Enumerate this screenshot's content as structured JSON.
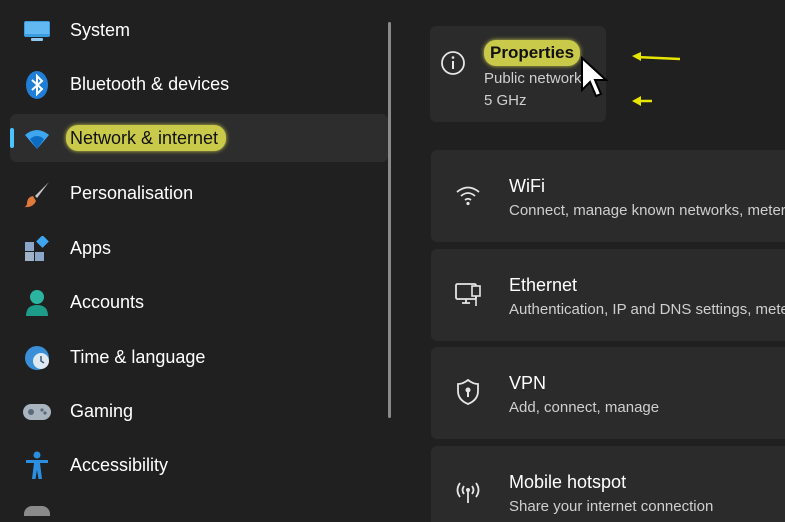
{
  "sidebar": {
    "items": [
      {
        "label": "System",
        "icon": "monitor-icon"
      },
      {
        "label": "Bluetooth & devices",
        "icon": "bluetooth-icon"
      },
      {
        "label": "Network & internet",
        "icon": "wifi-icon",
        "selected": true
      },
      {
        "label": "Personalisation",
        "icon": "brush-icon"
      },
      {
        "label": "Apps",
        "icon": "apps-icon"
      },
      {
        "label": "Accounts",
        "icon": "person-icon"
      },
      {
        "label": "Time & language",
        "icon": "globe-clock-icon"
      },
      {
        "label": "Gaming",
        "icon": "gamepad-icon"
      },
      {
        "label": "Accessibility",
        "icon": "accessibility-icon"
      }
    ]
  },
  "properties": {
    "title": "Properties",
    "network_type": "Public network",
    "band": "5 GHz",
    "icon": "info-icon"
  },
  "settings": [
    {
      "title": "WiFi",
      "desc": "Connect, manage known networks, metered network",
      "icon": "wifi-icon"
    },
    {
      "title": "Ethernet",
      "desc": "Authentication, IP and DNS settings, metered network",
      "icon": "ethernet-icon"
    },
    {
      "title": "VPN",
      "desc": "Add, connect, manage",
      "icon": "shield-icon"
    },
    {
      "title": "Mobile hotspot",
      "desc": "Share your internet connection",
      "icon": "hotspot-icon"
    }
  ],
  "colors": {
    "background": "#202020",
    "card": "#2b2b2b",
    "accent": "#4cc2ff",
    "highlight": "#c9c94a"
  }
}
